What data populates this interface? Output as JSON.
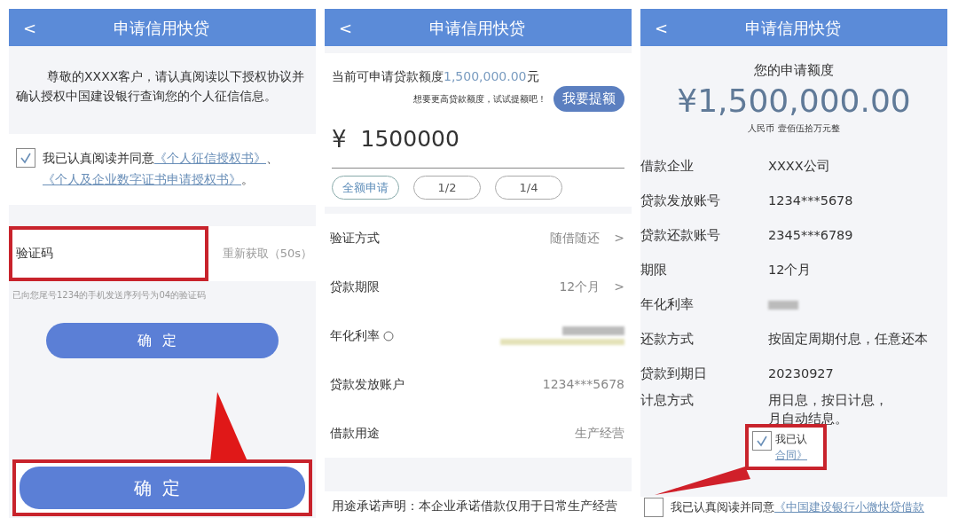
{
  "screen_1": {
    "title": "申请信用快贷",
    "back": "<",
    "intro": "尊敬的XXXX客户，请认真阅读以下授权协议并确认授权中国建设银行查询您的个人征信信息。",
    "agreement": {
      "checked": true,
      "text": "我已认真阅读并同意",
      "link_1": "《个人征信授权书》",
      "separator": "、",
      "link_2": "《个人及企业数字证书申请授权书》",
      "end": "。"
    },
    "code_field": {
      "label": "验证码",
      "highlighted": true
    },
    "resend": "重新获取（50s）",
    "hint": "已向您尾号1234的手机发送序列号为04的验证码",
    "confirm": "确定"
  },
  "screen_2": {
    "title": "申请信用快贷",
    "back": "<",
    "quota_label": "当前可申请贷款额度",
    "quota_value": "1,500,000.00",
    "quota_unit": "元",
    "upsell": "想要更高贷款额度，试试提额吧！",
    "raise_button": "我要提额",
    "currency": "¥",
    "amount": "1500000",
    "presets": [
      {
        "label": "全额申请",
        "selected": true
      },
      {
        "label": "1/2",
        "selected": false
      },
      {
        "label": "1/4",
        "selected": false
      }
    ],
    "rows": [
      {
        "kind": "select",
        "label": "验证方式",
        "value": "随借随还",
        "chevron": ">"
      },
      {
        "kind": "select",
        "label": "贷款期限",
        "value": "12个月",
        "chevron": ">"
      },
      {
        "kind": "redacted",
        "label": "年化利率"
      },
      {
        "kind": "text",
        "label": "贷款发放账户",
        "value": "1234***5678"
      },
      {
        "kind": "text",
        "label": "借款用途",
        "value": "生产经营"
      }
    ],
    "statement": "用途承诺声明：本企业承诺借款仅用于日常生产经营"
  },
  "screen_3": {
    "title": "申请信用快贷",
    "back": "<",
    "heading": "您的申请额度",
    "amount": "¥1,500,000.00",
    "amount_words": "人民币 壹佰伍拾万元整",
    "rows": [
      {
        "kind": "text",
        "label": "借款企业",
        "value": "XXXX公司"
      },
      {
        "kind": "text",
        "label": "贷款发放账号",
        "value": "1234***5678"
      },
      {
        "kind": "text",
        "label": "贷款还款账号",
        "value": "2345***6789"
      },
      {
        "kind": "text",
        "label": "期限",
        "value": "12个月"
      },
      {
        "kind": "redacted",
        "label": "年化利率"
      },
      {
        "kind": "text",
        "label": "还款方式",
        "value": "按固定周期付息，任意还本"
      },
      {
        "kind": "text",
        "label": "贷款到期日",
        "value": "20230927"
      },
      {
        "kind": "lines",
        "label": "计息方式",
        "lines": [
          "用日息，按日计息，",
          "月自动结息。"
        ]
      }
    ],
    "agreement": {
      "checked": false,
      "text": "我已认真阅读并同意",
      "link": "《中国建设银行小微快贷借款"
    }
  },
  "annotations": {
    "button_zoom": {
      "label": "确定"
    },
    "checkbox_zoom": {
      "checked": true,
      "text": "我已认",
      "link": "合同》"
    }
  }
}
